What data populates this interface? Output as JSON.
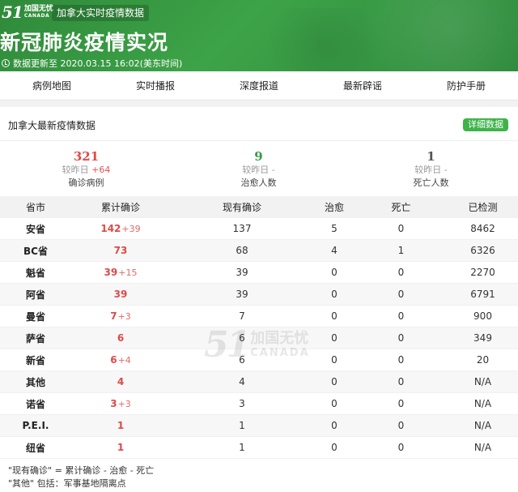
{
  "header": {
    "logo_num": "51",
    "logo_cn": "加国无忧",
    "logo_en": "CANADA",
    "tag": "加拿大实时疫情数据",
    "title": "新冠肺炎疫情实况",
    "update_text": "数据更新至 2020.03.15 16:02(美东时间)"
  },
  "nav": [
    "病例地图",
    "实时播报",
    "深度报道",
    "最新辟谣",
    "防护手册"
  ],
  "section": {
    "title": "加拿大最新疫情数据",
    "detail_button": "详细数据"
  },
  "summary": [
    {
      "value": "321",
      "diff_label": "较昨日",
      "diff": "+64",
      "label": "确诊病例",
      "color": "#e04949"
    },
    {
      "value": "9",
      "diff_label": "较昨日",
      "diff": "-",
      "label": "治愈人数",
      "color": "#3a9a47"
    },
    {
      "value": "1",
      "diff_label": "较昨日",
      "diff": "-",
      "label": "死亡人数",
      "color": "#555555"
    }
  ],
  "table": {
    "headers": [
      "省市",
      "累计确诊",
      "现有确诊",
      "治愈",
      "死亡",
      "已检测"
    ],
    "rows": [
      {
        "province": "安省",
        "confirmed": "142",
        "delta": "+39",
        "current": "137",
        "cured": "5",
        "dead": "0",
        "tested": "8462"
      },
      {
        "province": "BC省",
        "confirmed": "73",
        "delta": "",
        "current": "68",
        "cured": "4",
        "dead": "1",
        "tested": "6326"
      },
      {
        "province": "魁省",
        "confirmed": "39",
        "delta": "+15",
        "current": "39",
        "cured": "0",
        "dead": "0",
        "tested": "2270"
      },
      {
        "province": "阿省",
        "confirmed": "39",
        "delta": "",
        "current": "39",
        "cured": "0",
        "dead": "0",
        "tested": "6791"
      },
      {
        "province": "曼省",
        "confirmed": "7",
        "delta": "+3",
        "current": "7",
        "cured": "0",
        "dead": "0",
        "tested": "900"
      },
      {
        "province": "萨省",
        "confirmed": "6",
        "delta": "",
        "current": "6",
        "cured": "0",
        "dead": "0",
        "tested": "349"
      },
      {
        "province": "新省",
        "confirmed": "6",
        "delta": "+4",
        "current": "6",
        "cured": "0",
        "dead": "0",
        "tested": "20"
      },
      {
        "province": "其他",
        "confirmed": "4",
        "delta": "",
        "current": "4",
        "cured": "0",
        "dead": "0",
        "tested": "N/A"
      },
      {
        "province": "诺省",
        "confirmed": "3",
        "delta": "+3",
        "current": "3",
        "cured": "0",
        "dead": "0",
        "tested": "N/A"
      },
      {
        "province": "P.E.I.",
        "confirmed": "1",
        "delta": "",
        "current": "1",
        "cured": "0",
        "dead": "0",
        "tested": "N/A"
      },
      {
        "province": "纽省",
        "confirmed": "1",
        "delta": "",
        "current": "1",
        "cured": "0",
        "dead": "0",
        "tested": "N/A"
      }
    ]
  },
  "watermark": {
    "num": "51",
    "cn": "加国无忧",
    "en": "CANADA"
  },
  "notes": [
    "\"现有确诊\" = 累计确诊 - 治愈 - 死亡",
    "\"其他\" 包括：军事基地隔离点"
  ]
}
